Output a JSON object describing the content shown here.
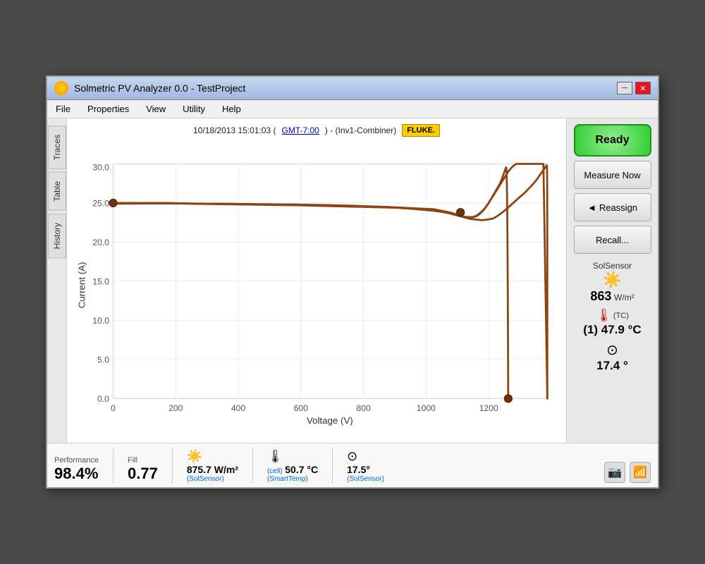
{
  "window": {
    "title": "Solmetric PV Analyzer 0.0 - TestProject",
    "minimize_label": "─",
    "close_label": "✕"
  },
  "menu": {
    "items": [
      "File",
      "Properties",
      "View",
      "Utility",
      "Help"
    ]
  },
  "chart": {
    "header_date": "10/18/2013 15:01:03 (",
    "header_gmt": "GMT-7:00",
    "header_mid": ") - (Inv1-Combiner)",
    "fluke_label": "FLUKE.",
    "x_label": "Voltage (V)",
    "y_label": "Current (A)",
    "x_ticks": [
      "0",
      "200",
      "400",
      "600",
      "800",
      "1000",
      "1200"
    ],
    "y_ticks": [
      "0.0",
      "5.0",
      "10.0",
      "15.0",
      "20.0",
      "25.0",
      "30.0"
    ]
  },
  "sidebar": {
    "tabs": [
      "Traces",
      "Table",
      "History"
    ]
  },
  "right_panel": {
    "ready_label": "Ready",
    "measure_now_label": "Measure Now",
    "reassign_label": "Reassign",
    "recall_label": "Recall...",
    "sol_sensor_label": "SolSensor",
    "irradiance_value": "863",
    "irradiance_unit": "W/m²",
    "tc_label": "(TC)",
    "temp_index": "(1)",
    "temp_value": "47.9",
    "temp_unit": "°C",
    "tilt_value": "17.4",
    "tilt_unit": "°"
  },
  "bottom_bar": {
    "performance_label": "Performance",
    "performance_value": "98.4%",
    "fill_label": "Fill",
    "fill_value": "0.77",
    "irradiance_value": "875.7 W/m²",
    "irradiance_sub": "(SolSensor)",
    "cell_temp_label": "(cell)",
    "cell_temp_value": "50.7 °C",
    "cell_temp_sub": "(SmartTemp)",
    "tilt_value": "17.5°",
    "tilt_sub": "(SolSensor)"
  },
  "toolbar": {
    "camera_icon": "📷",
    "signal_icon": "📶"
  }
}
